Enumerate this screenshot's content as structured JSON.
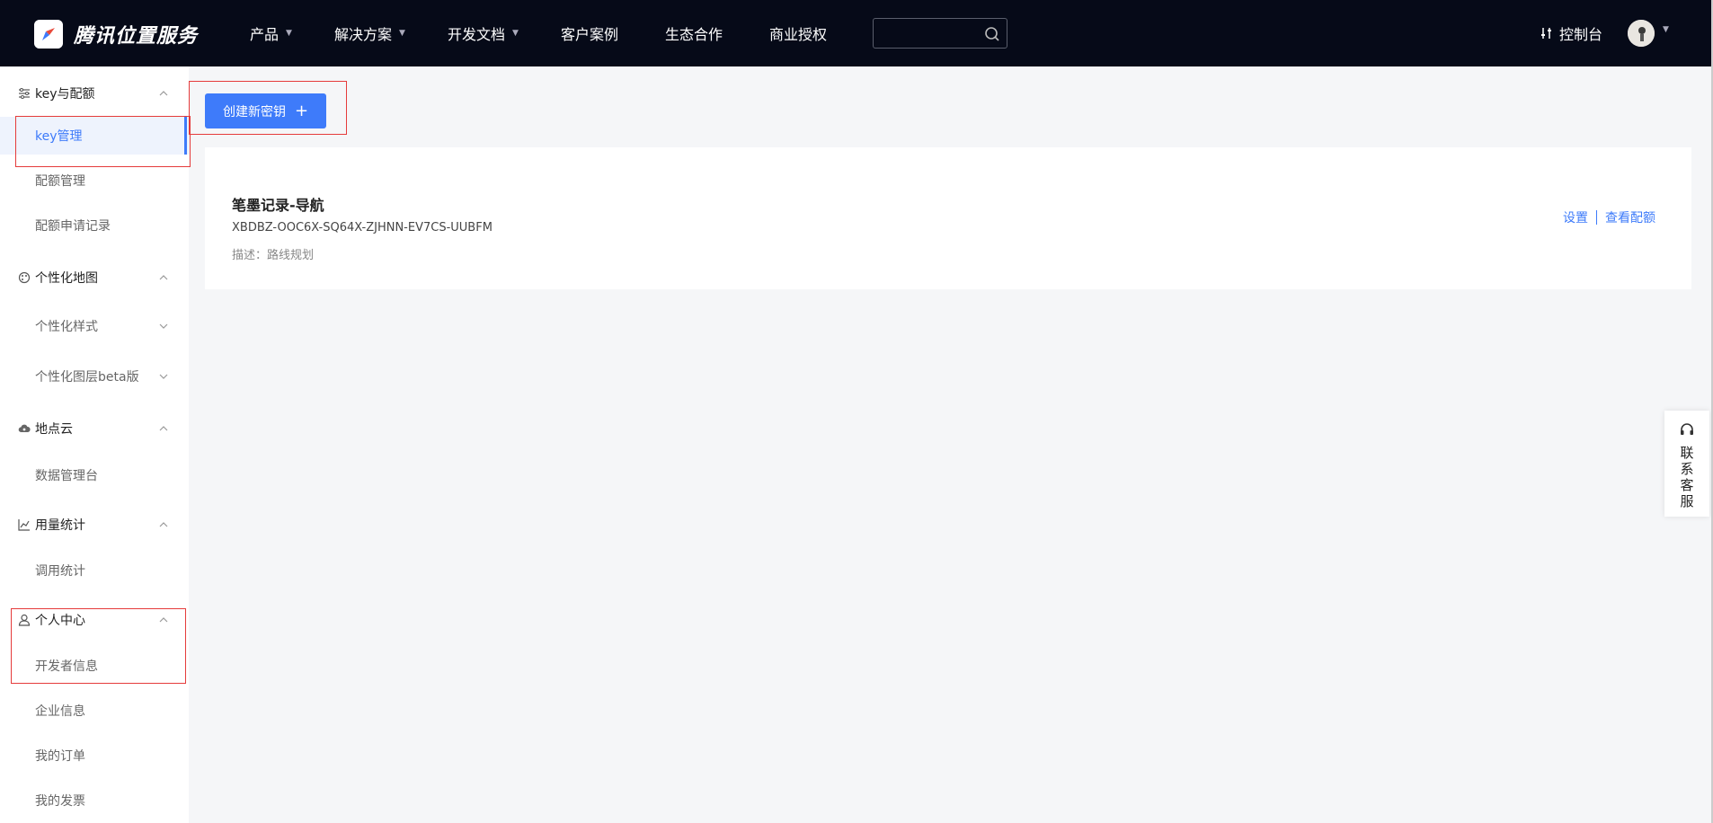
{
  "header": {
    "brand": "腾讯位置服务",
    "nav": [
      {
        "label": "产品",
        "has_caret": true
      },
      {
        "label": "解决方案",
        "has_caret": true
      },
      {
        "label": "开发文档",
        "has_caret": true
      },
      {
        "label": "客户案例",
        "has_caret": false
      },
      {
        "label": "生态合作",
        "has_caret": false
      },
      {
        "label": "商业授权",
        "has_caret": false
      }
    ],
    "search": {
      "placeholder": "",
      "icon": "search-icon"
    },
    "console_label": "控制台",
    "console_icon": "sliders-icon",
    "avatar_icon": "avatar"
  },
  "sidebar": {
    "sections": [
      {
        "label": "key与配额",
        "icon": "list-settings-icon",
        "items": [
          "key管理",
          "配额管理",
          "配额申请记录"
        ],
        "active_item": "key管理"
      },
      {
        "label": "个性化地图",
        "icon": "palette-icon",
        "items": [
          "个性化样式",
          "个性化图层beta版"
        ]
      },
      {
        "label": "地点云",
        "icon": "cloud-icon",
        "items": [
          "数据管理台"
        ]
      },
      {
        "label": "用量统计",
        "icon": "chart-line-icon",
        "items": [
          "调用统计"
        ]
      },
      {
        "label": "个人中心",
        "icon": "user-icon",
        "items": [
          "开发者信息",
          "企业信息",
          "我的订单",
          "我的发票"
        ]
      }
    ]
  },
  "main": {
    "create_button_label": "创建新密钥",
    "key_card": {
      "name": "笔墨记录-导航",
      "key": "XBDBZ-OOC6X-SQ64X-ZJHNN-EV7CS-UUBFM",
      "description": "描述：路线规划",
      "actions": [
        "设置",
        "查看配额"
      ]
    }
  },
  "contact": {
    "label": "联系客服",
    "icon": "headset-icon"
  },
  "colors": {
    "topbar": "#060a18",
    "accent": "#3e7bfa",
    "highlight_box": "#e53b3b"
  }
}
